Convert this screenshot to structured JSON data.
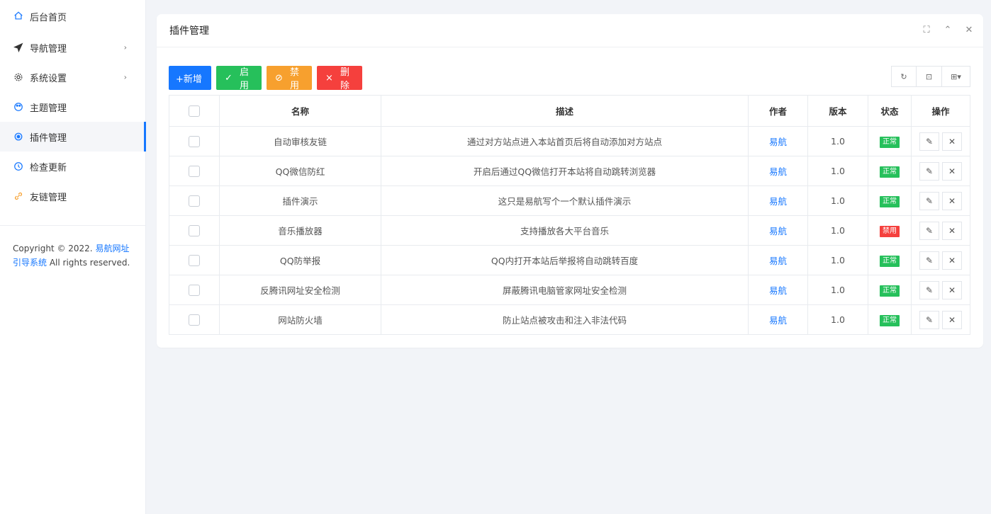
{
  "sidebar": {
    "items": [
      {
        "label": "后台首页",
        "icon": "home-icon",
        "arrow": false
      },
      {
        "label": "导航管理",
        "icon": "send-icon",
        "arrow": true
      },
      {
        "label": "系统设置",
        "icon": "gear-icon",
        "arrow": true
      },
      {
        "label": "主题管理",
        "icon": "palette-icon",
        "arrow": false
      },
      {
        "label": "插件管理",
        "icon": "plugin-icon",
        "arrow": false,
        "active": true
      },
      {
        "label": "检查更新",
        "icon": "refresh-icon",
        "arrow": false
      },
      {
        "label": "友链管理",
        "icon": "link-icon",
        "arrow": false
      }
    ],
    "arrow_glyph": "›",
    "copyright_prefix": "Copyright © 2022. ",
    "copyright_link": "易航网址引导系统",
    "copyright_suffix": " All rights reserved."
  },
  "card": {
    "title": "插件管理",
    "tools": {
      "fullscreen": "⛶",
      "collapse": "⌃",
      "close": "✕"
    }
  },
  "toolbar": {
    "add": "+新增",
    "enable_icon": "✓",
    "enable": "启用",
    "disable_icon": "⊘",
    "disable": "禁用",
    "delete_icon": "×",
    "delete": "删除"
  },
  "right_tools": {
    "refresh": "↻",
    "export": "⊡",
    "columns": "⊞▾"
  },
  "table": {
    "headers": {
      "name": "名称",
      "desc": "描述",
      "author": "作者",
      "version": "版本",
      "status": "状态",
      "ops": "操作"
    },
    "rows": [
      {
        "name": "自动审核友链",
        "desc": "通过对方站点进入本站首页后将自动添加对方站点",
        "author": "易航",
        "version": "1.0",
        "status": "正常",
        "ok": true
      },
      {
        "name": "QQ微信防红",
        "desc": "开启后通过QQ微信打开本站将自动跳转浏览器",
        "author": "易航",
        "version": "1.0",
        "status": "正常",
        "ok": true
      },
      {
        "name": "插件演示",
        "desc": "这只是易航写个一个默认插件演示",
        "author": "易航",
        "version": "1.0",
        "status": "正常",
        "ok": true
      },
      {
        "name": "音乐播放器",
        "desc": "支持播放各大平台音乐",
        "author": "易航",
        "version": "1.0",
        "status": "禁用",
        "ok": false
      },
      {
        "name": "QQ防举报",
        "desc": "QQ内打开本站后举报将自动跳转百度",
        "author": "易航",
        "version": "1.0",
        "status": "正常",
        "ok": true
      },
      {
        "name": "反腾讯网址安全检测",
        "desc": "屏蔽腾讯电脑管家网址安全检测",
        "author": "易航",
        "version": "1.0",
        "status": "正常",
        "ok": true
      },
      {
        "name": "网站防火墙",
        "desc": "防止站点被攻击和注入非法代码",
        "author": "易航",
        "version": "1.0",
        "status": "正常",
        "ok": true
      }
    ],
    "edit_glyph": "✎",
    "delete_glyph": "✕"
  },
  "colors": {
    "primary": "#1677ff",
    "success": "#26c05b",
    "warning": "#f7a02e",
    "danger": "#f5403d"
  }
}
